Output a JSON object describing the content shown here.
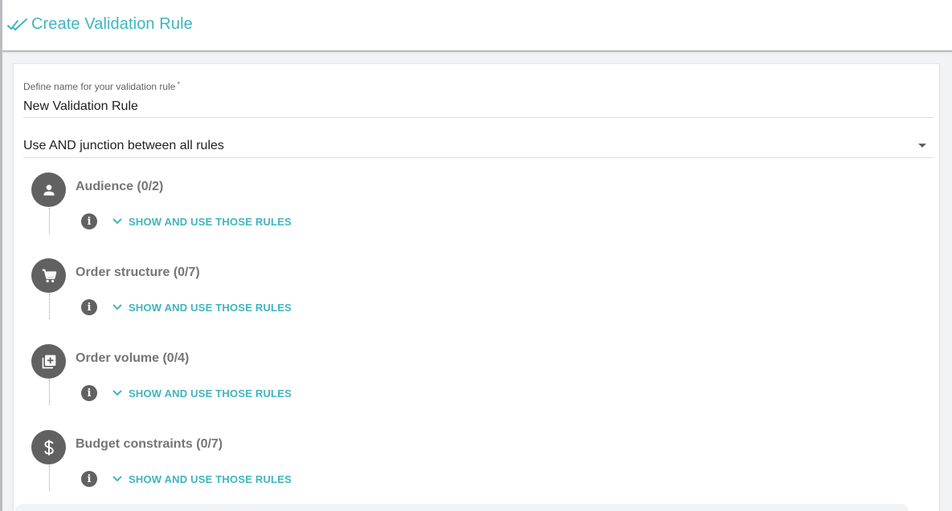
{
  "header": {
    "title": "Create Validation Rule",
    "icon": "double-check-icon",
    "accent_color": "#3fb5be"
  },
  "form": {
    "name_label": "Define name for your validation rule",
    "required_mark": "*",
    "name_value": "New Validation Rule",
    "junction_value": "Use AND junction between all rules"
  },
  "sections": [
    {
      "icon": "person-icon",
      "title": "Audience (0/2)",
      "toggle_label": "SHOW AND USE THOSE RULES"
    },
    {
      "icon": "cart-icon",
      "title": "Order structure (0/7)",
      "toggle_label": "SHOW AND USE THOSE RULES"
    },
    {
      "icon": "library-add-icon",
      "title": "Order volume (0/4)",
      "toggle_label": "SHOW AND USE THOSE RULES"
    },
    {
      "icon": "dollar-icon",
      "title": "Budget constraints (0/7)",
      "toggle_label": "SHOW AND USE THOSE RULES"
    }
  ],
  "info_glyph": "i"
}
